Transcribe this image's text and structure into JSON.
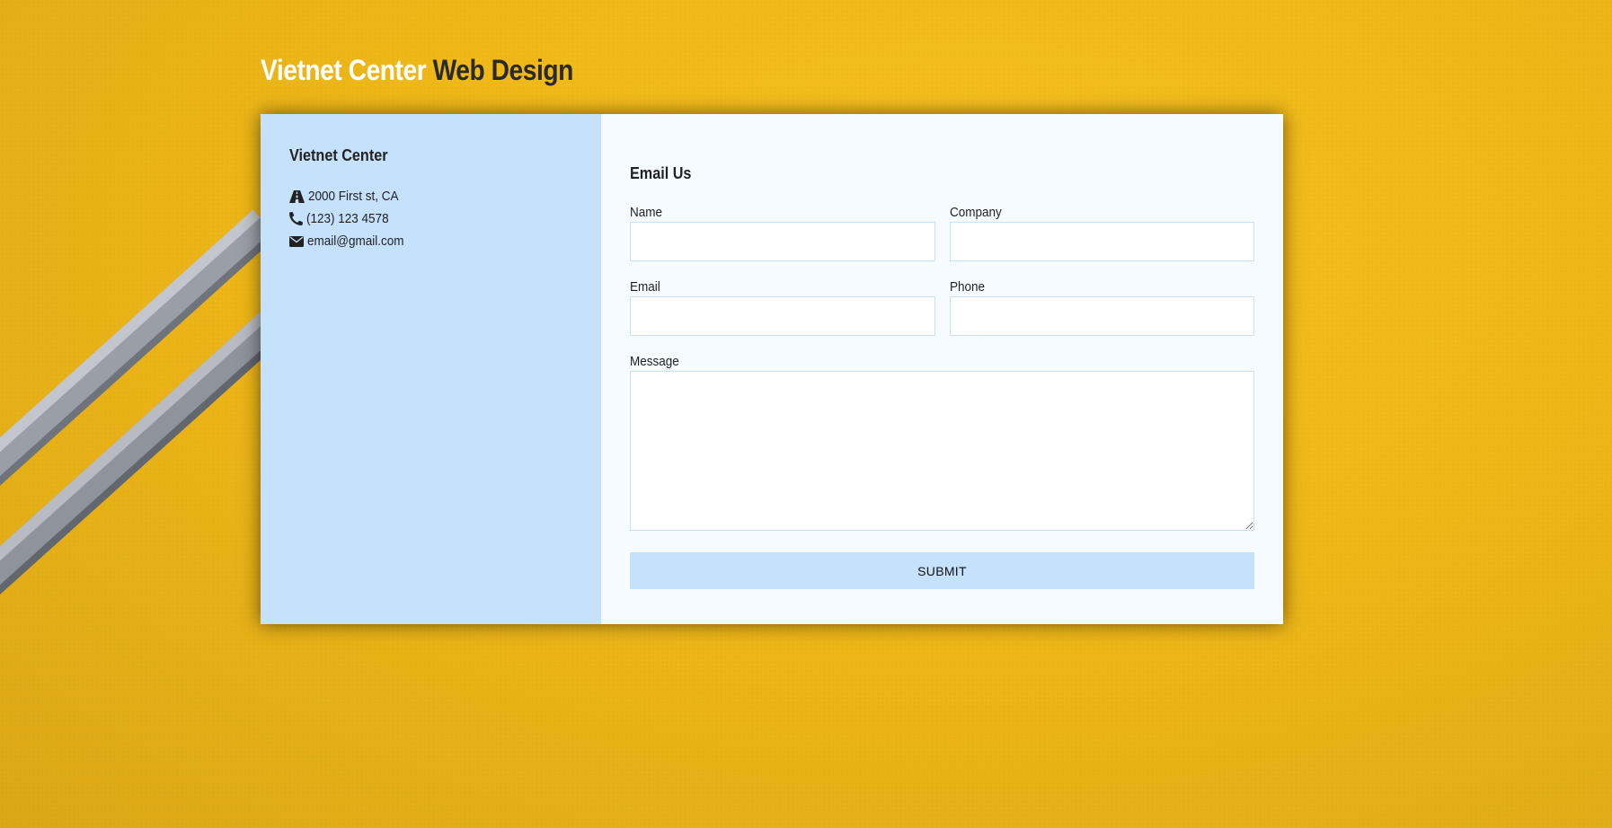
{
  "header": {
    "brand_light": "Vietnet Center",
    "brand_dark": "Web Design"
  },
  "contact_info": {
    "title": "Vietnet Center",
    "address": "2000 First st, CA",
    "phone": "(123) 123 4578",
    "email": "email@gmail.com",
    "icons": [
      "road-icon",
      "phone-icon",
      "envelope-icon"
    ]
  },
  "form": {
    "title": "Email Us",
    "name_label": "Name",
    "name_value": "",
    "company_label": "Company",
    "company_value": "",
    "email_label": "Email",
    "email_value": "",
    "phone_label": "Phone",
    "phone_value": "",
    "message_label": "Message",
    "message_value": "",
    "submit_label": "SUBMIT"
  },
  "colors": {
    "background": "#f2bb1a",
    "info_panel": "#c5e1fb",
    "form_panel": "#f6fbff",
    "input_border": "#c7e1f7",
    "submit_button": "#c5e1fb",
    "brand_light": "#ffffff",
    "brand_dark": "#2a2a2a"
  }
}
